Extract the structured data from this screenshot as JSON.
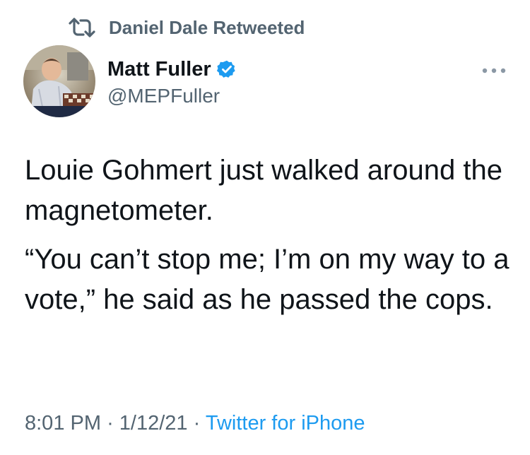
{
  "retweet": {
    "icon": "retweet-icon",
    "text": "Daniel Dale Retweeted"
  },
  "author": {
    "avatar": "avatar",
    "display_name": "Matt Fuller",
    "verified_icon": "verified-badge-icon",
    "handle": "@MEPFuller"
  },
  "more_icon": "more-icon",
  "tweet": {
    "paragraphs": [
      "Louie Gohmert just walked around the magnetometer.",
      "“You can’t stop me; I’m on my way to a vote,” he said as he passed the cops."
    ]
  },
  "meta": {
    "time": "8:01 PM",
    "separator": "·",
    "date": "1/12/21",
    "source": "Twitter for iPhone"
  },
  "colors": {
    "text": "#0f1419",
    "secondary": "#536471",
    "link": "#1d9bf0",
    "verified": "#1d9bf0"
  }
}
